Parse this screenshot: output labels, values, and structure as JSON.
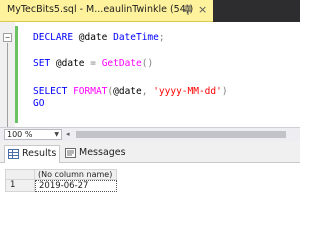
{
  "tab": {
    "title": "MyTecBits5.sql - M...eaulinTwinkle (54))",
    "close_glyph": "×",
    "background_color": "#fff29d"
  },
  "editor": {
    "collapse_glyph": "−",
    "lines": [
      [
        {
          "t": "DECLARE",
          "c": "kw"
        },
        {
          "t": " @date ",
          "c": "plain"
        },
        {
          "t": "DateTime",
          "c": "kw"
        },
        {
          "t": ";",
          "c": "op"
        }
      ],
      [
        {
          "t": "SET",
          "c": "kw"
        },
        {
          "t": " @date ",
          "c": "plain"
        },
        {
          "t": "=",
          "c": "op"
        },
        {
          "t": " ",
          "c": "plain"
        },
        {
          "t": "GetDate",
          "c": "fn"
        },
        {
          "t": "()",
          "c": "op"
        }
      ],
      [
        {
          "t": "SELECT",
          "c": "kw"
        },
        {
          "t": " ",
          "c": "plain"
        },
        {
          "t": "FORMAT",
          "c": "fn"
        },
        {
          "t": "(",
          "c": "op"
        },
        {
          "t": "@date",
          "c": "plain"
        },
        {
          "t": ", ",
          "c": "op"
        },
        {
          "t": "'yyyy-MM-dd'",
          "c": "str"
        },
        {
          "t": ")",
          "c": "op"
        }
      ],
      [
        {
          "t": "GO",
          "c": "kw"
        }
      ]
    ],
    "change_bar_color": "#6cc164"
  },
  "status": {
    "zoom": "100 %",
    "zoom_arrow": "▼",
    "scroll_left_arrow": "◂"
  },
  "results": {
    "tabs": [
      {
        "label": "Results",
        "icon": "grid-icon",
        "active": true
      },
      {
        "label": "Messages",
        "icon": "messages-icon",
        "active": false
      }
    ],
    "grid": {
      "columns": [
        "(No column name)"
      ],
      "rows": [
        {
          "num": "1",
          "values": [
            "2019-06-27"
          ]
        }
      ]
    }
  }
}
